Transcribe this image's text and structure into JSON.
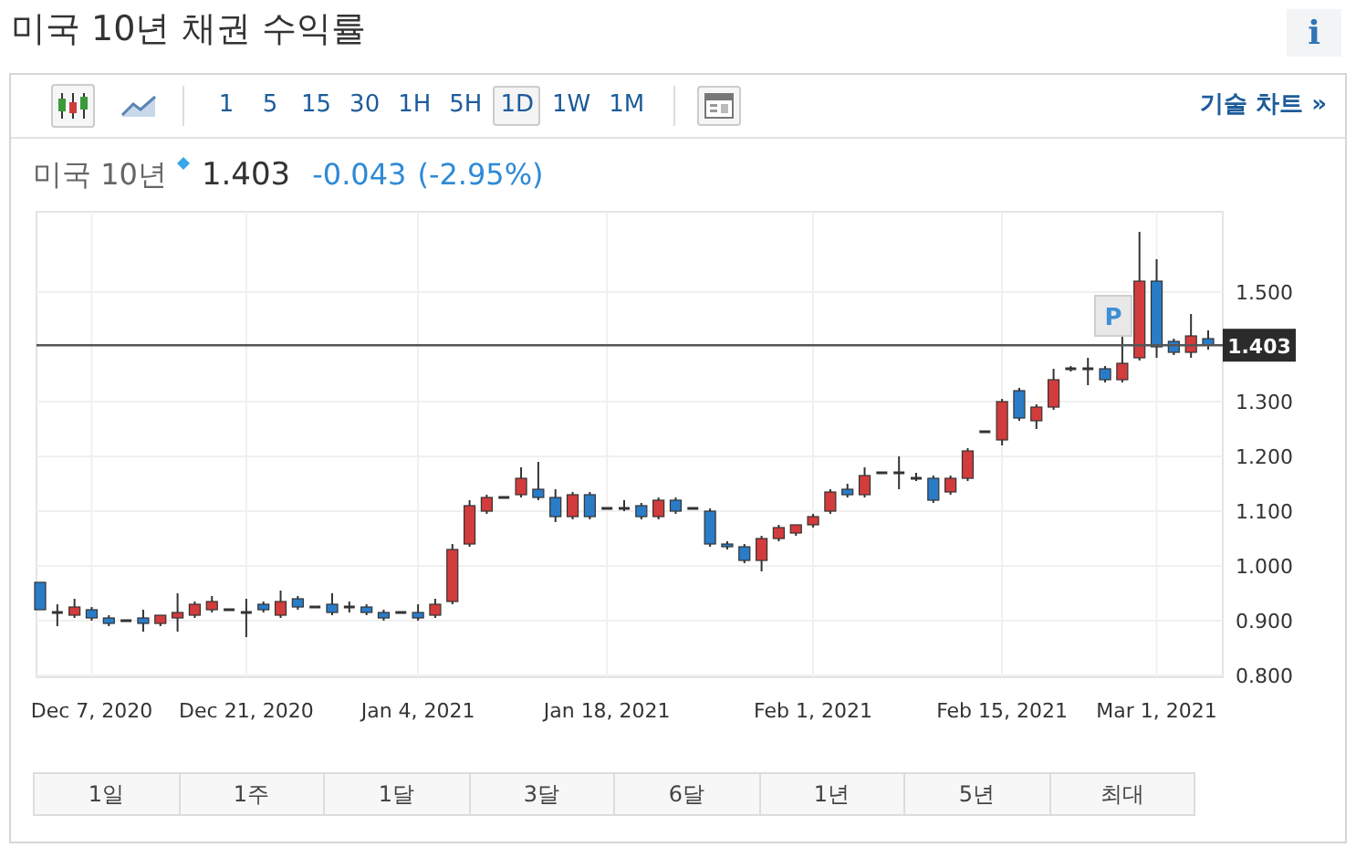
{
  "title": "미국 10년 채권 수익률",
  "info_button": "i",
  "toolbar": {
    "chart_types": [
      {
        "kind": "candlestick",
        "selected": true
      },
      {
        "kind": "line",
        "selected": false
      }
    ],
    "intervals": [
      {
        "label": "1",
        "selected": false
      },
      {
        "label": "5",
        "selected": false
      },
      {
        "label": "15",
        "selected": false
      },
      {
        "label": "30",
        "selected": false
      },
      {
        "label": "1H",
        "selected": false
      },
      {
        "label": "5H",
        "selected": false
      },
      {
        "label": "1D",
        "selected": true
      },
      {
        "label": "1W",
        "selected": false
      },
      {
        "label": "1M",
        "selected": false
      }
    ],
    "technical_chart_link": "기술 차트 »"
  },
  "quote": {
    "name": "미국 10년",
    "price": "1.403",
    "change": "-0.043",
    "change_percent": "(-2.95%)"
  },
  "chart": {
    "current_price_label": "1.403",
    "marker": "P",
    "chart_data": {
      "type": "candlestick",
      "categories": [
        null,
        null,
        null,
        "Dec 7, 2020",
        null,
        null,
        null,
        null,
        null,
        null,
        null,
        null,
        "Dec 21, 2020",
        null,
        null,
        null,
        null,
        null,
        null,
        null,
        null,
        null,
        "Jan 4, 2021",
        null,
        null,
        null,
        null,
        null,
        null,
        null,
        null,
        null,
        null,
        "Jan 18, 2021",
        null,
        null,
        null,
        null,
        null,
        null,
        null,
        null,
        null,
        null,
        null,
        "Feb 1, 2021",
        null,
        null,
        null,
        null,
        null,
        null,
        null,
        null,
        null,
        null,
        "Feb 15, 2021",
        null,
        null,
        null,
        null,
        null,
        null,
        null,
        null,
        "Mar 1, 2021",
        null,
        null,
        null
      ],
      "ohlc": [
        [
          0.97,
          0.97,
          0.92,
          0.92
        ],
        [
          0.915,
          0.93,
          0.89,
          0.915
        ],
        [
          0.91,
          0.94,
          0.905,
          0.925
        ],
        [
          0.92,
          0.925,
          0.9,
          0.905
        ],
        [
          0.905,
          0.91,
          0.89,
          0.895
        ],
        [
          0.9,
          0.9,
          0.9,
          0.9
        ],
        [
          0.905,
          0.92,
          0.88,
          0.895
        ],
        [
          0.895,
          0.91,
          0.89,
          0.91
        ],
        [
          0.905,
          0.95,
          0.88,
          0.915
        ],
        [
          0.91,
          0.935,
          0.905,
          0.93
        ],
        [
          0.92,
          0.945,
          0.915,
          0.935
        ],
        [
          0.92,
          0.92,
          0.92,
          0.92
        ],
        [
          0.915,
          0.94,
          0.87,
          0.915
        ],
        [
          0.93,
          0.935,
          0.915,
          0.92
        ],
        [
          0.91,
          0.955,
          0.905,
          0.935
        ],
        [
          0.94,
          0.945,
          0.92,
          0.925
        ],
        [
          0.925,
          0.925,
          0.925,
          0.925
        ],
        [
          0.93,
          0.95,
          0.91,
          0.915
        ],
        [
          0.925,
          0.935,
          0.915,
          0.925
        ],
        [
          0.925,
          0.93,
          0.91,
          0.915
        ],
        [
          0.915,
          0.92,
          0.9,
          0.905
        ],
        [
          0.915,
          0.915,
          0.915,
          0.915
        ],
        [
          0.915,
          0.93,
          0.9,
          0.905
        ],
        [
          0.91,
          0.94,
          0.905,
          0.93
        ],
        [
          0.935,
          1.04,
          0.93,
          1.03
        ],
        [
          1.04,
          1.12,
          1.035,
          1.11
        ],
        [
          1.1,
          1.13,
          1.095,
          1.125
        ],
        [
          1.125,
          1.125,
          1.125,
          1.125
        ],
        [
          1.13,
          1.18,
          1.125,
          1.16
        ],
        [
          1.14,
          1.19,
          1.12,
          1.125
        ],
        [
          1.125,
          1.14,
          1.08,
          1.09
        ],
        [
          1.09,
          1.135,
          1.085,
          1.13
        ],
        [
          1.13,
          1.135,
          1.085,
          1.09
        ],
        [
          1.105,
          1.105,
          1.105,
          1.105
        ],
        [
          1.105,
          1.12,
          1.1,
          1.105
        ],
        [
          1.11,
          1.115,
          1.085,
          1.09
        ],
        [
          1.09,
          1.125,
          1.085,
          1.12
        ],
        [
          1.12,
          1.125,
          1.095,
          1.1
        ],
        [
          1.105,
          1.105,
          1.105,
          1.105
        ],
        [
          1.1,
          1.105,
          1.035,
          1.04
        ],
        [
          1.04,
          1.045,
          1.03,
          1.035
        ],
        [
          1.035,
          1.04,
          1.005,
          1.01
        ],
        [
          1.01,
          1.055,
          0.99,
          1.05
        ],
        [
          1.05,
          1.075,
          1.045,
          1.07
        ],
        [
          1.06,
          1.075,
          1.055,
          1.075
        ],
        [
          1.075,
          1.095,
          1.07,
          1.09
        ],
        [
          1.1,
          1.14,
          1.095,
          1.135
        ],
        [
          1.14,
          1.15,
          1.125,
          1.13
        ],
        [
          1.13,
          1.18,
          1.125,
          1.165
        ],
        [
          1.17,
          1.17,
          1.17,
          1.17
        ],
        [
          1.17,
          1.2,
          1.14,
          1.17
        ],
        [
          1.16,
          1.17,
          1.155,
          1.16
        ],
        [
          1.16,
          1.165,
          1.115,
          1.12
        ],
        [
          1.135,
          1.165,
          1.13,
          1.16
        ],
        [
          1.16,
          1.215,
          1.155,
          1.21
        ],
        [
          1.245,
          1.245,
          1.245,
          1.245
        ],
        [
          1.23,
          1.305,
          1.22,
          1.3
        ],
        [
          1.32,
          1.325,
          1.265,
          1.27
        ],
        [
          1.265,
          1.295,
          1.25,
          1.29
        ],
        [
          1.29,
          1.36,
          1.285,
          1.34
        ],
        [
          1.36,
          1.365,
          1.355,
          1.36
        ],
        [
          1.36,
          1.38,
          1.33,
          1.36
        ],
        [
          1.36,
          1.365,
          1.335,
          1.34
        ],
        [
          1.34,
          1.42,
          1.335,
          1.37
        ],
        [
          1.38,
          1.61,
          1.375,
          1.52
        ],
        [
          1.52,
          1.56,
          1.38,
          1.4
        ],
        [
          1.41,
          1.415,
          1.385,
          1.39
        ],
        [
          1.39,
          1.46,
          1.38,
          1.42
        ],
        [
          1.415,
          1.43,
          1.395,
          1.403
        ]
      ],
      "ylim": [
        0.8,
        1.65
      ],
      "grid": true,
      "ref_lines": [
        {
          "axis": "y",
          "value": 1.403
        }
      ],
      "yticks": [
        {
          "value": 0.8,
          "label": "0.800"
        },
        {
          "value": 0.9,
          "label": "0.900"
        },
        {
          "value": 1.0,
          "label": "1.000"
        },
        {
          "value": 1.1,
          "label": "1.100"
        },
        {
          "value": 1.2,
          "label": "1.200"
        },
        {
          "value": 1.3,
          "label": "1.300"
        },
        {
          "value": 1.5,
          "label": "1.500"
        }
      ]
    }
  },
  "range_buttons": [
    {
      "label": "1일"
    },
    {
      "label": "1주"
    },
    {
      "label": "1달"
    },
    {
      "label": "3달"
    },
    {
      "label": "6달"
    },
    {
      "label": "1년"
    },
    {
      "label": "5년"
    },
    {
      "label": "최대"
    }
  ]
}
